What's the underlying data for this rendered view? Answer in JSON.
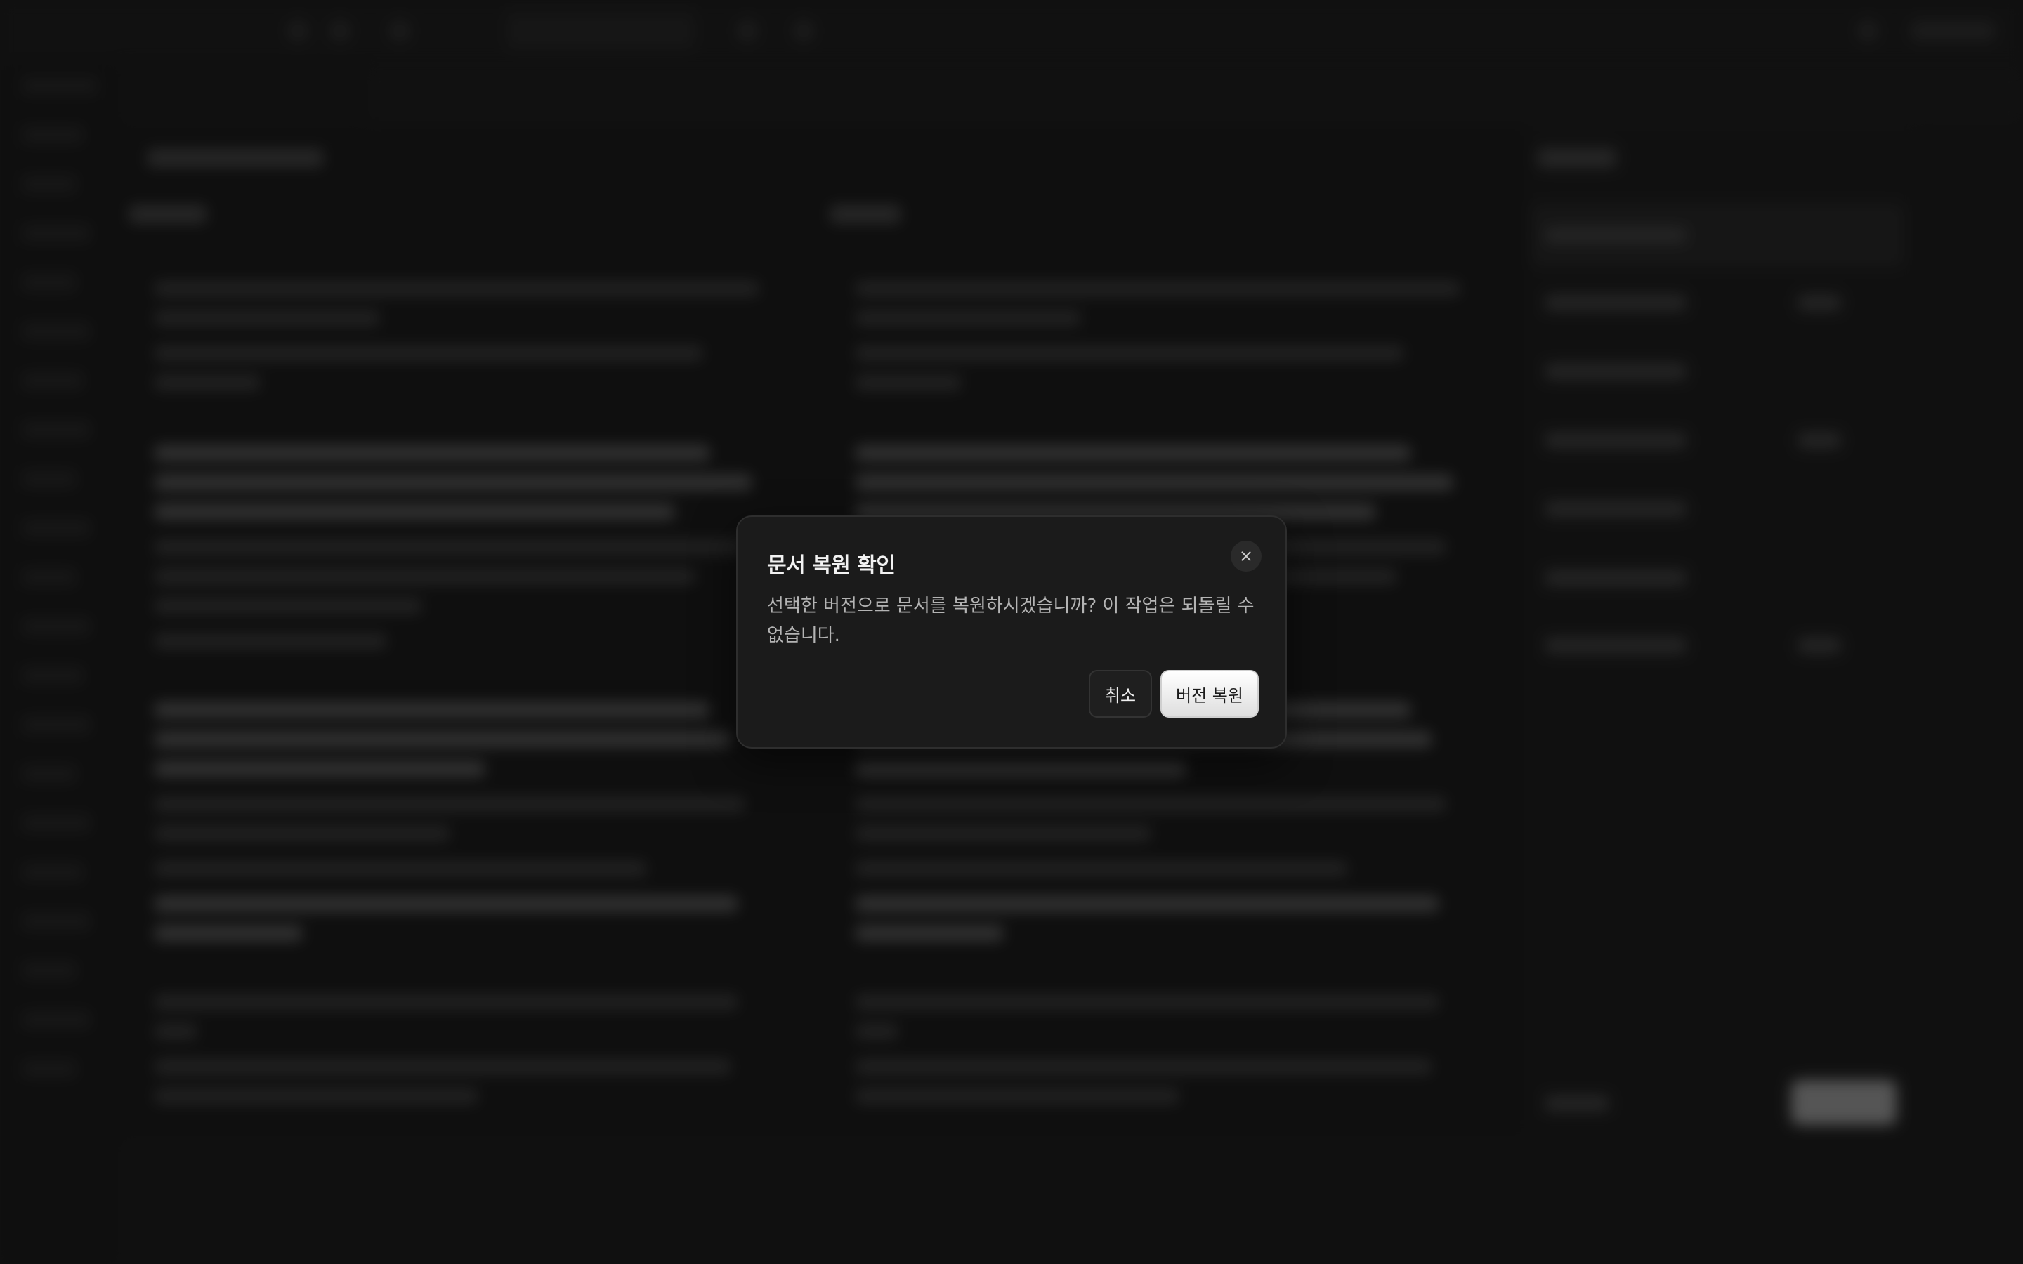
{
  "dialog": {
    "title": "문서 복원 확인",
    "message": "선택한 버전으로 문서를 복원하시겠습니까? 이 작업은 되돌릴 수 없습니다.",
    "cancel_label": "취소",
    "confirm_label": "버전 복원",
    "close_icon": "close-icon"
  },
  "colors": {
    "dialog_bg": "#1b1b1b",
    "confirm_bg": "#ececec",
    "overlay": "#000000"
  }
}
